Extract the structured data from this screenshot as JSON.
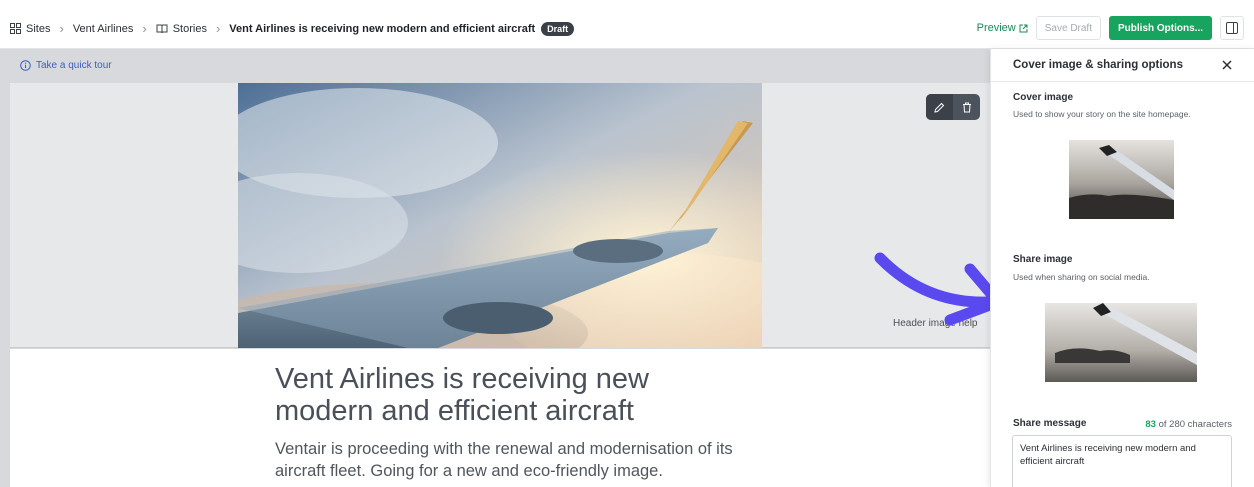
{
  "breadcrumb": {
    "sites": "Sites",
    "site_name": "Vent Airlines",
    "stories": "Stories",
    "story_title": "Vent Airlines is receiving new modern and efficient aircraft",
    "status_badge": "Draft"
  },
  "toolbar": {
    "preview": "Preview",
    "save_draft": "Save Draft",
    "publish": "Publish Options..."
  },
  "editor": {
    "tour_link": "Take a quick tour",
    "header_image_help": "Header image help",
    "story_title": "Vent Airlines is receiving new modern and efficient aircraft",
    "story_subtitle": "Ventair is proceeding with the renewal and modernisation of its aircraft fleet. Going for a new and eco-friendly image."
  },
  "panel": {
    "title": "Cover image & sharing options",
    "cover_title": "Cover image",
    "cover_desc": "Used to show your story on the site homepage.",
    "share_image_title": "Share image",
    "share_image_desc": "Used when sharing on social media.",
    "share_message_title": "Share message",
    "count_used": "83",
    "count_rest": " of 280 characters",
    "share_message_value": "Vent Airlines is receiving new modern and efficient aircraft"
  },
  "colors": {
    "accent_green": "#17a45f",
    "link_blue": "#3b5fc0",
    "arrow_purple": "#5b49f0"
  }
}
